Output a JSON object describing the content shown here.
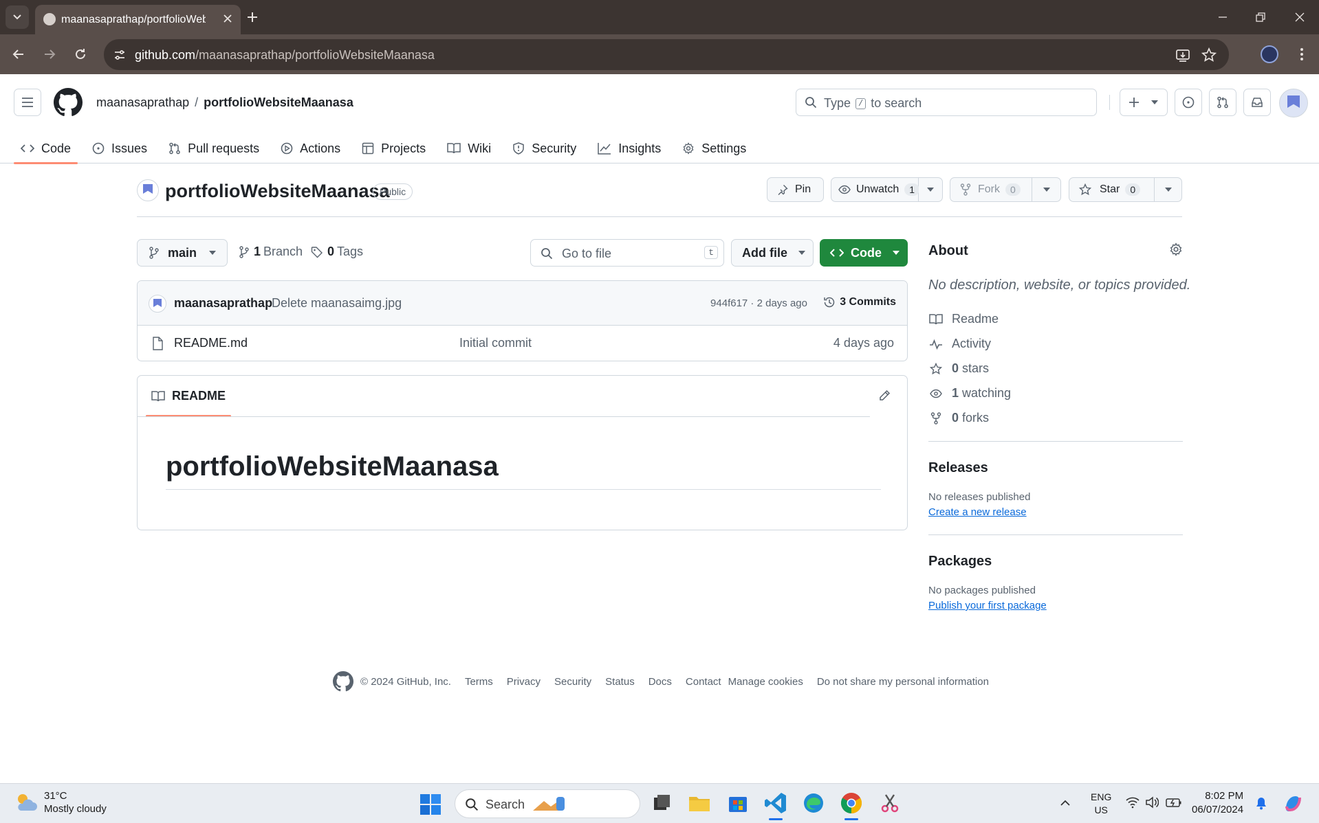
{
  "browser": {
    "tab_title": "maanasaprathap/portfolioWebsiteMaanasa",
    "url_host": "github.com",
    "url_path": "/maanasaprathap/portfolioWebsiteMaanasa"
  },
  "github": {
    "owner": "maanasaprathap",
    "separator": "/",
    "repo": "portfolioWebsiteMaanasa",
    "search_prefix": "Type",
    "search_key": "/",
    "search_suffix": "to search",
    "nav": [
      "Code",
      "Issues",
      "Pull requests",
      "Actions",
      "Projects",
      "Wiki",
      "Security",
      "Insights",
      "Settings"
    ]
  },
  "repo": {
    "name": "portfolioWebsiteMaanasa",
    "visibility": "Public",
    "pin_label": "Pin",
    "unwatch_label": "Unwatch",
    "unwatch_count": "1",
    "fork_label": "Fork",
    "fork_count": "0",
    "star_label": "Star",
    "star_count": "0"
  },
  "filenav": {
    "branch": "main",
    "branches_count": "1",
    "branches_label": "Branch",
    "tags_count": "0",
    "tags_label": "Tags",
    "goto_placeholder": "Go to file",
    "goto_key": "t",
    "add_file": "Add file",
    "code": "Code"
  },
  "latest_commit": {
    "author": "maanasaprathap",
    "message": "Delete maanasaimg.jpg",
    "meta": "944f617 · 2 days ago",
    "commits_label": "3 Commits"
  },
  "files": [
    {
      "name": "README.md",
      "message": "Initial commit",
      "date": "4 days ago"
    }
  ],
  "readme": {
    "tab_label": "README",
    "heading": "portfolioWebsiteMaanasa"
  },
  "about": {
    "heading": "About",
    "description": "No description, website, or topics provided.",
    "readme": "Readme",
    "activity": "Activity",
    "stars_count": "0",
    "stars_label": "stars",
    "watching_count": "1",
    "watching_label": "watching",
    "forks_count": "0",
    "forks_label": "forks"
  },
  "releases": {
    "heading": "Releases",
    "none": "No releases published",
    "link": "Create a new release"
  },
  "packages": {
    "heading": "Packages",
    "none": "No packages published",
    "link": "Publish your first package"
  },
  "footer": {
    "copyright": "© 2024 GitHub, Inc.",
    "links": [
      "Terms",
      "Privacy",
      "Security",
      "Status",
      "Docs",
      "Contact",
      "Manage cookies",
      "Do not share my personal information"
    ]
  },
  "taskbar": {
    "temp": "31°C",
    "condition": "Mostly cloudy",
    "search": "Search",
    "lang1": "ENG",
    "lang2": "US",
    "time": "8:02 PM",
    "date": "06/07/2024"
  },
  "colors": {
    "accent_green": "#1f883d",
    "link_blue": "#0969da",
    "tab_underline": "#fd8c73"
  }
}
